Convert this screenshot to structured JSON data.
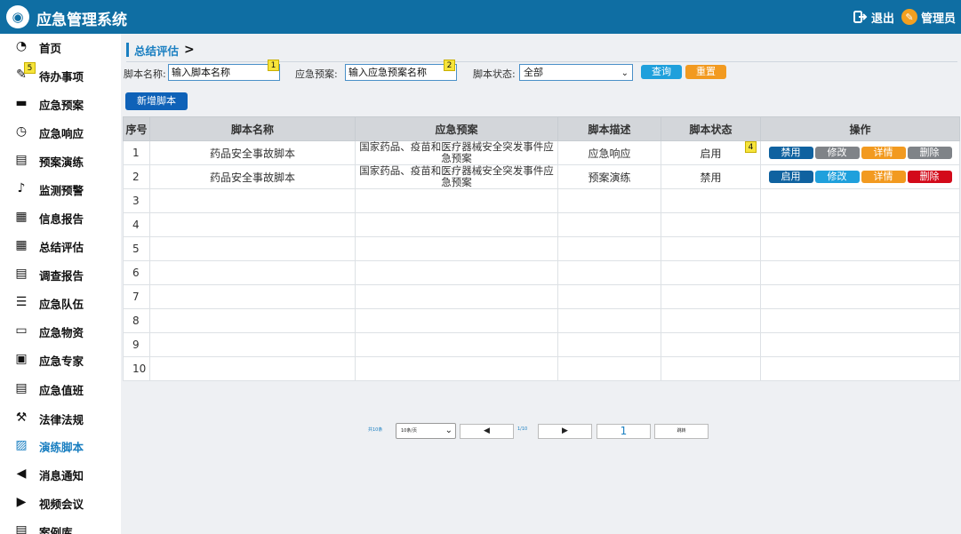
{
  "app": {
    "title": "应急管理系统",
    "logout": "退出",
    "user": "管理员"
  },
  "sidebar": {
    "badge": "5",
    "items": [
      {
        "label": "首页",
        "icon": "pie-chart-icon",
        "glyph": "◔"
      },
      {
        "label": "待办事项",
        "icon": "edit-icon",
        "glyph": "✎"
      },
      {
        "label": "应急预案",
        "icon": "archive-icon",
        "glyph": "▬"
      },
      {
        "label": "应急响应",
        "icon": "clock-icon",
        "glyph": "◷"
      },
      {
        "label": "预案演练",
        "icon": "building-icon",
        "glyph": "▤"
      },
      {
        "label": "监测预警",
        "icon": "bell-icon",
        "glyph": "♪"
      },
      {
        "label": "信息报告",
        "icon": "newspaper-icon",
        "glyph": "▦"
      },
      {
        "label": "总结评估",
        "icon": "table-icon",
        "glyph": "▦"
      },
      {
        "label": "调查报告",
        "icon": "file-text-icon",
        "glyph": "▤"
      },
      {
        "label": "应急队伍",
        "icon": "list-icon",
        "glyph": "☰"
      },
      {
        "label": "应急物资",
        "icon": "laptop-icon",
        "glyph": "▭"
      },
      {
        "label": "应急专家",
        "icon": "id-card-icon",
        "glyph": "▣"
      },
      {
        "label": "应急值班",
        "icon": "document-icon",
        "glyph": "▤"
      },
      {
        "label": "法律法规",
        "icon": "gavel-icon",
        "glyph": "⚒"
      },
      {
        "label": "演练脚本",
        "icon": "image-icon",
        "glyph": "▨"
      },
      {
        "label": "消息通知",
        "icon": "bullhorn-icon",
        "glyph": "◀"
      },
      {
        "label": "视频会议",
        "icon": "play-circle-icon",
        "glyph": "▶"
      },
      {
        "label": "案例库",
        "icon": "document-icon",
        "glyph": "▤"
      }
    ]
  },
  "breadcrumb": {
    "current": "总结评估",
    "arrow": ">"
  },
  "filters": {
    "script_name_label": "脚本名称:",
    "script_name_value": "输入脚本名称",
    "plan_label": "应急预案:",
    "plan_value": "输入应急预案名称",
    "status_label": "脚本状态:",
    "status_value": "全部",
    "query": "查询",
    "reset": "重置",
    "tag1": "1",
    "tag2": "2"
  },
  "add_button": "新增脚本",
  "status_tag": "4",
  "table": {
    "headers": [
      "序号",
      "脚本名称",
      "应急预案",
      "脚本描述",
      "脚本状态",
      "操作"
    ],
    "rows": [
      {
        "seq": "1",
        "name": "药品安全事故脚本",
        "plan": "国家药品、疫苗和医疗器械安全突发事件应急预案",
        "desc": "应急响应",
        "status": "启用",
        "ops": [
          "禁用",
          "修改",
          "详情",
          "删除"
        ]
      },
      {
        "seq": "2",
        "name": "药品安全事故脚本",
        "plan": "国家药品、疫苗和医疗器械安全突发事件应急预案",
        "desc": "预案演练",
        "status": "禁用",
        "ops": [
          "启用",
          "修改",
          "详情",
          "删除"
        ]
      }
    ],
    "empty_seq": [
      "3",
      "4",
      "5",
      "6",
      "7",
      "8",
      "9",
      "10"
    ]
  },
  "pager": {
    "total": "共10条",
    "page_size": "10条/页",
    "prev": "◀",
    "page_info": "1/10",
    "next": "▶",
    "page_input": "1",
    "jump": "跳转"
  },
  "colors": {
    "topbar": "#0f6ea3",
    "accent": "#1a7fc1",
    "query": "#1fa0dc",
    "reset": "#f29a20",
    "danger": "#d30a1a"
  }
}
